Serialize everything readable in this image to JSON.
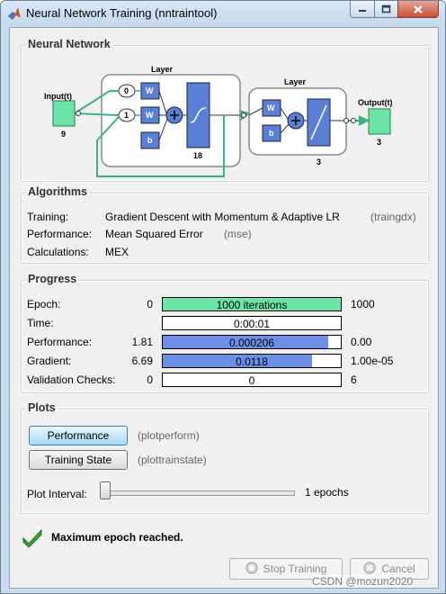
{
  "window": {
    "title": "Neural Network Training (nntraintool)"
  },
  "network": {
    "section_title": "Neural Network",
    "input_label": "Input(t)",
    "input_size": "9",
    "layer1_label": "Layer",
    "layer1_size": "18",
    "delay0": "0",
    "delay1": "1",
    "w_label": "W",
    "b_label": "b",
    "layer2_label": "Layer",
    "layer2_size": "3",
    "output_label": "Output(t)",
    "output_size": "3"
  },
  "algorithms": {
    "section_title": "Algorithms",
    "rows": [
      {
        "label": "Training:",
        "value": "Gradient Descent with Momentum & Adaptive LR",
        "code": "(traingdx)"
      },
      {
        "label": "Performance:",
        "value": "Mean Squared Error",
        "code": "(mse)"
      },
      {
        "label": "Calculations:",
        "value": "MEX",
        "code": ""
      }
    ]
  },
  "progress": {
    "section_title": "Progress",
    "rows": [
      {
        "label": "Epoch:",
        "start": "0",
        "text": "1000 iterations",
        "end": "1000",
        "fill": 1.0,
        "color": "#6ce4a6"
      },
      {
        "label": "Time:",
        "start": "",
        "text": "0:00:01",
        "end": "",
        "fill": 0,
        "color": "#6d8fe6"
      },
      {
        "label": "Performance:",
        "start": "1.81",
        "text": "0.000206",
        "end": "0.00",
        "fill": 0.93,
        "color": "#6d8fe6"
      },
      {
        "label": "Gradient:",
        "start": "6.69",
        "text": "0.0118",
        "end": "1.00e-05",
        "fill": 0.84,
        "color": "#6d8fe6"
      },
      {
        "label": "Validation Checks:",
        "start": "0",
        "text": "0",
        "end": "6",
        "fill": 0,
        "color": "#6d8fe6"
      }
    ]
  },
  "plots": {
    "section_title": "Plots",
    "buttons": [
      {
        "label": "Performance",
        "code": "(plotperform)"
      },
      {
        "label": "Training State",
        "code": "(plottrainstate)"
      }
    ],
    "interval_label": "Plot Interval:",
    "interval_value": "1 epochs"
  },
  "status": {
    "message": "Maximum epoch reached."
  },
  "footer": {
    "stop_label": "Stop Training",
    "cancel_label": "Cancel",
    "watermark": "CSDN @mozun2020"
  },
  "colors": {
    "accent": "#6ce4a6",
    "bar_blue": "#6d8fe6",
    "node_blue": "#5a7fd6",
    "check": "#3aa83a"
  }
}
